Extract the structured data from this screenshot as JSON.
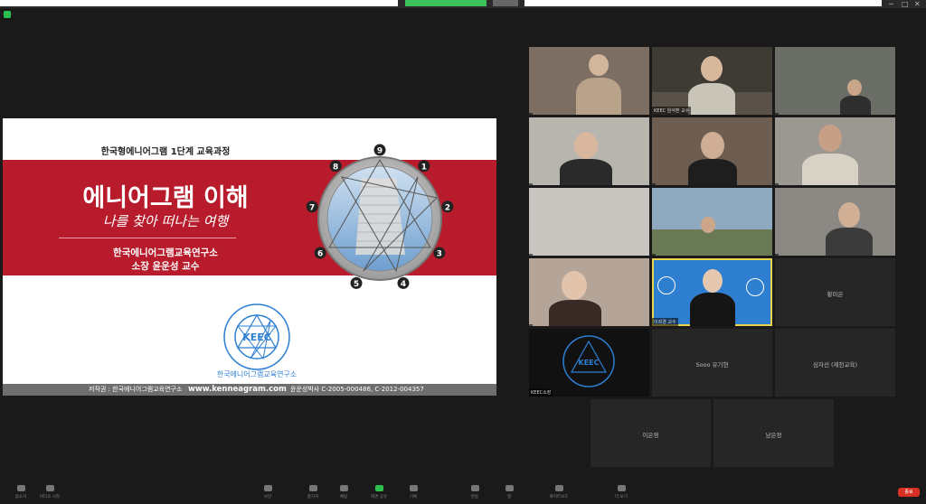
{
  "window": {
    "title": "",
    "accent_green": "#2fbf4f"
  },
  "slide": {
    "course_title": "한국형에니어그램 1단계 교육과정",
    "main_title": "에니어그램 이해",
    "subtitle": "나를 찾아 떠나는 여행",
    "org": "한국에니어그램교육연구소",
    "presenter": "소장 윤운성 교수",
    "logo_text": "KEEC",
    "logo_ring_text": "한국에니어그램교육연구소",
    "footer_copyright": "저작권 : 한국에니어그램교육연구소",
    "footer_url": "www.kenneagram.com",
    "footer_license": "윤운성박사 C-2005-000486, C-2012-004357",
    "enneagram_points": [
      "9",
      "1",
      "2",
      "3",
      "4",
      "5",
      "6",
      "7",
      "8"
    ],
    "band_color": "#b81c2c"
  },
  "participants": [
    {
      "name": ""
    },
    {
      "name": "KEEC 임석환 교수"
    },
    {
      "name": ""
    },
    {
      "name": ""
    },
    {
      "name": ""
    },
    {
      "name": ""
    },
    {
      "name": ""
    },
    {
      "name": ""
    },
    {
      "name": ""
    },
    {
      "name": ""
    },
    {
      "name": "이희경 교수"
    },
    {
      "name": "황미은"
    },
    {
      "name": "KEEC소장"
    },
    {
      "name": "Sooo 유기현"
    },
    {
      "name": "심자선 (제천교육)"
    },
    {
      "name": "이은영"
    },
    {
      "name": "남은정"
    }
  ],
  "toolbar": {
    "buttons": [
      "음소거",
      "비디오 시작",
      "보안",
      "참가자",
      "채팅",
      "화면 공유",
      "기록",
      "반응",
      "앱",
      "화이트보드",
      "더 보기"
    ],
    "end_label": "종료"
  }
}
